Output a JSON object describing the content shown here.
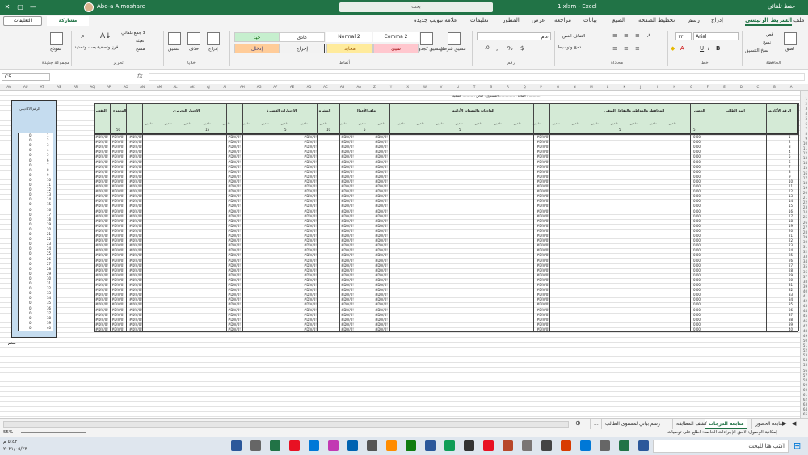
{
  "titlebar": {
    "autosave": "حفظ تلقائي",
    "filename": "1.xlsm  -  Excel",
    "search": "بحث",
    "user": "Abo-a Almoshare",
    "accent": "#217346"
  },
  "menu": {
    "tabs": [
      "ملف",
      "الشريط الرئيسي",
      "إدراج",
      "رسم",
      "تخطيط الصفحة",
      "الصيغ",
      "بيانات",
      "مراجعة",
      "عرض",
      "المطور",
      "تعليمات",
      "علامة تبويب جديدة"
    ],
    "comments": "التعليقات",
    "share": "مشاركة"
  },
  "ribbon": {
    "clipboard": {
      "paste": "لصق",
      "cut": "قص",
      "copy": "نسخ",
      "format_painter": "نسخ التنسيق",
      "label": "الحافظة"
    },
    "font": {
      "name": "Arial",
      "size": "١٢",
      "label": "خط"
    },
    "alignment": {
      "wrap": "التفاف النص",
      "merge": "دمج وتوسيط",
      "label": "محاذاة"
    },
    "number": {
      "format": "عام",
      "label": "رقم"
    },
    "styles": {
      "conditional": "تنسيق شرطي",
      "as_table": "التنسيق كجدول",
      "cells": [
        "Normal 2",
        "Comma 2",
        "عادي",
        "جيد",
        "محايد",
        "سيئ",
        "إخراج",
        "إدخال"
      ],
      "label": "أنماط"
    },
    "cells": {
      "insert": "إدراج",
      "delete": "حذف",
      "format": "تنسيق",
      "label": "خلايا"
    },
    "editing": {
      "autosum": "جمع تلقائي",
      "fill": "تعبئة",
      "clear": "مسح",
      "sort": "فرز وتصفية",
      "find": "بحث وتحديد",
      "label": "تحرير"
    },
    "newgroup": {
      "form": "نموذج",
      "label": "مجموعة جديدة"
    }
  },
  "formula": {
    "namebox": "C5",
    "fx": "fx",
    "value": ""
  },
  "sheet": {
    "col_letters": [
      "A",
      "B",
      "C",
      "D",
      "E",
      "F",
      "G",
      "H",
      "I",
      "J",
      "K",
      "L",
      "M",
      "N",
      "O",
      "P",
      "Q",
      "R",
      "S",
      "T",
      "U",
      "V",
      "W",
      "X",
      "Y",
      "Z",
      "AA",
      "AB",
      "AC",
      "AD",
      "AE",
      "AF",
      "AG",
      "AH",
      "AI",
      "AJ",
      "AK",
      "AL",
      "AM",
      "AN",
      "AO",
      "AP",
      "AQ",
      "AR",
      "AS",
      "AT",
      "AU",
      "AV"
    ],
    "header_info": "المادة : ...............   المستوى : الثاني ............  الشعبة : ...........",
    "headers": {
      "academic_no": "الرقم الأكاديمي",
      "student_name": "اسم الطالب",
      "attendance": "الحضور",
      "participation": "المحافظة والمواظبة والتفاعل الصفي",
      "homework": "الواجبات والمهمات الأدائية",
      "activities": "ملف الأعمال",
      "project": "المشروع",
      "short_tests": "الاختبارات القصيرة",
      "written": "الاختبار التحريري",
      "total": "المجموع",
      "grade": "التقدير",
      "left_header": "الرقم الأكاديمي",
      "col_rating": "تقدير",
      "weights": [
        "5",
        "5",
        "5",
        "5",
        "10",
        "5",
        "15",
        "50"
      ]
    },
    "row_error": "#DIV/0!",
    "row_zero": "0.00",
    "row_count": 40,
    "footer_note": "معلم"
  },
  "sheets": {
    "tabs": [
      "متابعة الدرجات",
      "متابعة الحضور",
      "رسم بياني لمستوى الطالب",
      "كشف المطابقة",
      "..."
    ],
    "active": "متابعة الدرجات"
  },
  "status": {
    "zoom": "55%",
    "accessibility": "إمكانية الوصول: لاحق الإجراءات الخاصة: اطلع على توصيات"
  },
  "taskbar": {
    "search": "اكتب هنا للبحث",
    "time": "٥:٤٣ م",
    "date": "٢٠٢١/٠٥/٢٣"
  }
}
